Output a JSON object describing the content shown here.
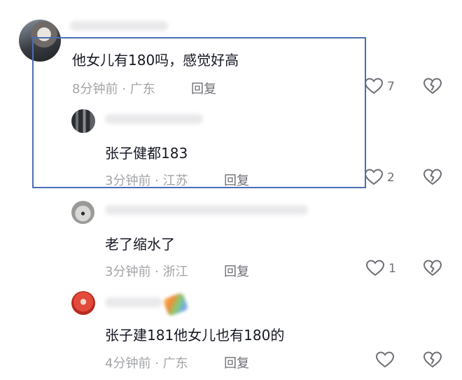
{
  "comments": [
    {
      "text": "他女儿有180吗，感觉好高",
      "meta": "8分钟前 · 广东",
      "reply_label": "回复",
      "like_count": "7"
    },
    {
      "text": "张子健都183",
      "meta": "3分钟前 · 江苏",
      "reply_label": "回复",
      "like_count": "2"
    },
    {
      "text": "老了缩水了",
      "meta": "3分钟前 · 浙江",
      "reply_label": "回复",
      "like_count": "1"
    },
    {
      "text": "张子建181他女儿也有180的",
      "meta": "4分钟前 · 广东",
      "reply_label": "回复",
      "like_count": ""
    }
  ],
  "icons": {
    "like": "heart-outline-icon",
    "dislike": "broken-heart-icon"
  },
  "colors": {
    "highlight_border": "#4a6eb5",
    "text": "#161823",
    "meta": "#a3a4a8"
  }
}
